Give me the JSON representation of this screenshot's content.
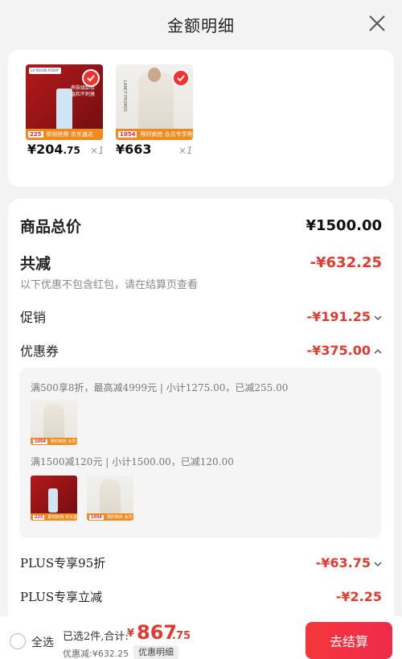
{
  "header": {
    "title": "金额明细"
  },
  "products": [
    {
      "price_int": "¥204",
      "price_dec": ".75",
      "qty": "×1",
      "brand": "LA ROCHE-POSAY",
      "image_text": "养肤级卸妆 温和不刺激",
      "tag_num": "225",
      "tag_text": "即刻抢购 京东速达"
    },
    {
      "price_int": "¥663",
      "price_dec": "",
      "qty": "×1",
      "brand": "LANCY FROM25",
      "tag_num": "1054",
      "tag_text": "限时疯抢 会员专享购"
    }
  ],
  "details": {
    "total_label": "商品总价",
    "total_value": "¥1500.00",
    "reduce_label": "共减",
    "reduce_value": "-¥632.25",
    "note": "以下优惠不包含红包，请在结算页查看",
    "promo_label": "促销",
    "promo_value": "-¥191.25",
    "coupon_label": "优惠券",
    "coupon_value": "-¥375.00",
    "coupon_line1": "满500享8折，最高减4999元 | 小计1275.00，已减255.00",
    "coupon_line2": "满1500减120元 | 小计1500.00，已减120.00",
    "plus95_label": "PLUS专享95折",
    "plus95_value": "-¥63.75",
    "plusdirect_label": "PLUS专享立减",
    "plusdirect_value": "-¥2.25"
  },
  "footer": {
    "select_all": "全选",
    "summary": "已选2件,合计:",
    "currency": "¥",
    "total_int": "867",
    "total_dec": ".75",
    "discount": "优惠减:¥632.25",
    "detail_chip": "优惠明细",
    "checkout": "去结算"
  },
  "colors": {
    "accent": "#e33a2f",
    "button": "#f4373a",
    "badge_orange": "#f08a1c"
  },
  "icons": {
    "close": "close-icon",
    "check": "check-icon",
    "chevron_down": "chevron-down-icon",
    "chevron_up": "chevron-up-icon",
    "radio": "radio-unchecked-icon"
  }
}
